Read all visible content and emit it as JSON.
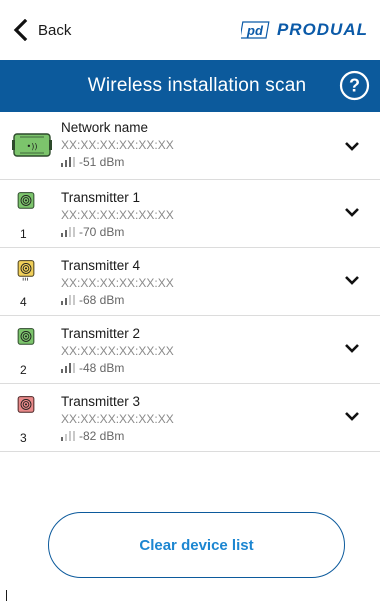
{
  "topbar": {
    "back_label": "Back",
    "logo_text": "PRODUAL",
    "logo_mark": "pd",
    "colors": {
      "brand": "#0b5aa8"
    }
  },
  "header": {
    "title": "Wireless installation scan",
    "help_icon": "question-mark-circle-icon",
    "colors": {
      "background": "#0c5a9c",
      "text": "#ffffff"
    }
  },
  "devices": [
    {
      "name": "Network name",
      "mac": "XX:XX:XX:XX:XX:XX",
      "rssi": "-51 dBm",
      "bars": 3,
      "icon": "gateway-icon",
      "number": "",
      "color": "#7cc46c"
    },
    {
      "name": "Transmitter 1",
      "mac": "XX:XX:XX:XX:XX:XX",
      "rssi": "-70 dBm",
      "bars": 2,
      "icon": "transmitter-icon",
      "number": "1",
      "color": "#7cc46c"
    },
    {
      "name": "Transmitter 4",
      "mac": "XX:XX:XX:XX:XX:XX",
      "rssi": "-68 dBm",
      "bars": 2,
      "icon": "transmitter-icon",
      "number": "4",
      "color": "#f0cf5a"
    },
    {
      "name": "Transmitter 2",
      "mac": "XX:XX:XX:XX:XX:XX",
      "rssi": "-48 dBm",
      "bars": 3,
      "icon": "transmitter-icon",
      "number": "2",
      "color": "#7cc46c"
    },
    {
      "name": "Transmitter 3",
      "mac": "XX:XX:XX:XX:XX:XX",
      "rssi": "-82 dBm",
      "bars": 1,
      "icon": "transmitter-icon",
      "number": "3",
      "color": "#e88a8a"
    }
  ],
  "actions": {
    "clear_label": "Clear device list",
    "colors": {
      "outline": "#0c5a9c",
      "text": "#1c86d1"
    }
  }
}
